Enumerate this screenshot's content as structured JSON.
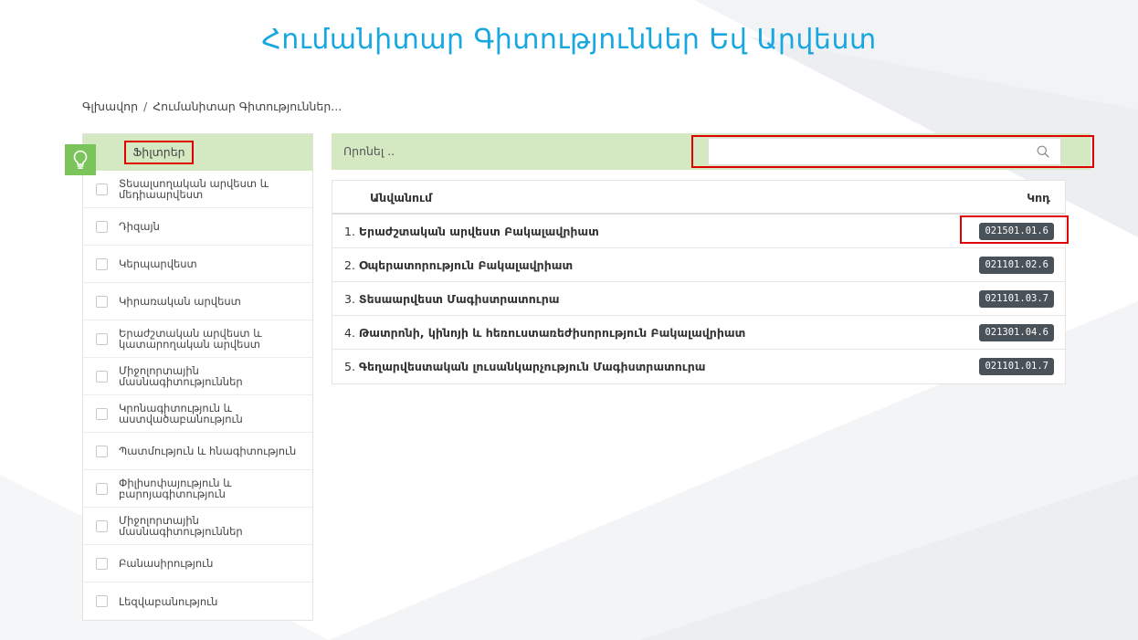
{
  "page": {
    "title": "Հումանիտար Գիտություններ Եվ Արվեստ"
  },
  "breadcrumb": {
    "home": "Գլխավոր",
    "separator": "/",
    "current": "Հումանիտար Գիտություններ..."
  },
  "sidebar": {
    "header_label": "Ֆիլտրեր",
    "items": [
      {
        "label": "Տեսալսողական արվեստ և մեդիաարվեստ",
        "checked": false
      },
      {
        "label": "Դիզայն",
        "checked": false
      },
      {
        "label": "Կերպարվեստ",
        "checked": false
      },
      {
        "label": "Կիրառական արվեստ",
        "checked": false
      },
      {
        "label": "Երաժշտական արվեստ և կատարողական արվեստ",
        "checked": false
      },
      {
        "label": "Միջոլորտային մասնագիտություններ",
        "checked": false
      },
      {
        "label": "Կրոնագիտություն և աստվածաբանություն",
        "checked": false
      },
      {
        "label": "Պատմություն և հնագիտություն",
        "checked": false
      },
      {
        "label": "Փիլիսոփայություն և բարոյագիտություն",
        "checked": false
      },
      {
        "label": "Միջոլորտային մասնագիտություններ",
        "checked": false
      },
      {
        "label": "Բանասիրություն",
        "checked": false
      },
      {
        "label": "Լեզվաբանություն",
        "checked": false
      }
    ]
  },
  "search": {
    "label": "Որոնել ..",
    "value": "",
    "placeholder": ""
  },
  "table": {
    "headers": {
      "name": "Անվանում",
      "code": "Կոդ"
    },
    "rows": [
      {
        "index": "1.",
        "name": "Երաժշտական արվեստ Բակալավրիատ",
        "code": "021501.01.6"
      },
      {
        "index": "2.",
        "name": "Օպերատորություն Բակալավրիատ",
        "code": "021101.02.6"
      },
      {
        "index": "3.",
        "name": "Տեսաարվեստ Մագիստրատուրա",
        "code": "021101.03.7"
      },
      {
        "index": "4.",
        "name": "Թատրոնի, կինոյի և հեռուստառեժիսորություն Բակալավրիատ",
        "code": "021301.04.6"
      },
      {
        "index": "5.",
        "name": "Գեղարվեստական լուսանկարչություն Մագիստրատուրա",
        "code": "021101.01.7"
      }
    ]
  },
  "colors": {
    "title_blue": "#18a7e0",
    "header_green": "#d4e8c2",
    "bulb_green": "#7bc35b",
    "badge_dark": "#4a5259",
    "highlight_red": "#e00000"
  },
  "icons": {
    "bulb": "lightbulb-icon",
    "search": "search-icon"
  }
}
